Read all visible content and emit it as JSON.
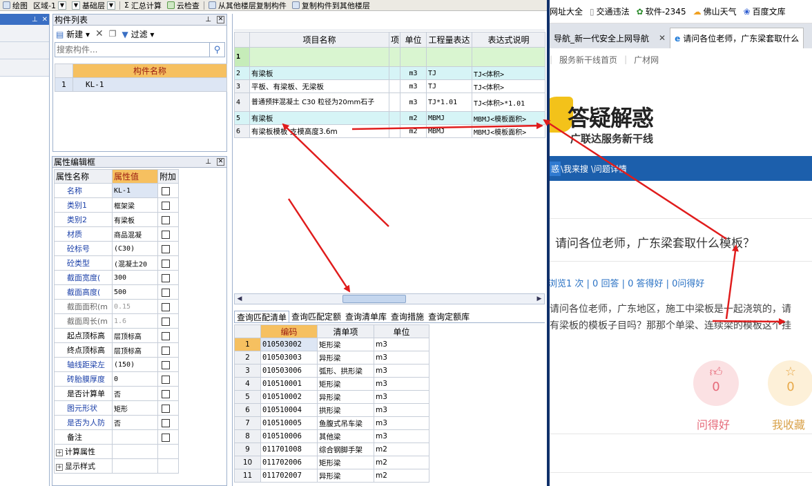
{
  "toolbar": {
    "items": [
      "绘图",
      "区域-1",
      "基础层",
      "汇总计算",
      "云检查",
      "从其他楼层复制构件",
      "复制构件到其他楼层"
    ]
  },
  "component_list": {
    "title": "构件列表",
    "new_label": "新建",
    "filter_label": "过滤",
    "search_placeholder": "搜索构件...",
    "col_header": "构件名称",
    "rows": [
      {
        "num": "1",
        "name": "KL-1"
      }
    ]
  },
  "prop_editor": {
    "title": "属性编辑框",
    "headers": [
      "属性名称",
      "属性值",
      "附加"
    ],
    "rows": [
      {
        "name": "名称",
        "value": "KL-1"
      },
      {
        "name": "类别1",
        "value": "框架梁"
      },
      {
        "name": "类别2",
        "value": "有梁板"
      },
      {
        "name": "材质",
        "value": "商品混凝"
      },
      {
        "name": "砼标号",
        "value": "(C30)"
      },
      {
        "name": "砼类型",
        "value": "(混凝土20"
      },
      {
        "name": "截面宽度(",
        "value": "300"
      },
      {
        "name": "截面高度(",
        "value": "500"
      },
      {
        "name": "截面面积(m",
        "value": "0.15"
      },
      {
        "name": "截面周长(m",
        "value": "1.6"
      },
      {
        "name": "起点顶标高",
        "value": "层顶标高"
      },
      {
        "name": "终点顶标高",
        "value": "层顶标高"
      },
      {
        "name": "轴线距梁左",
        "value": "(150)"
      },
      {
        "name": "砖胎膜厚度",
        "value": "0"
      },
      {
        "name": "是否计算单",
        "value": "否"
      },
      {
        "name": "图元形状",
        "value": "矩形"
      },
      {
        "name": "是否为人防",
        "value": "否"
      },
      {
        "name": "备注",
        "value": ""
      }
    ],
    "groups": [
      "计算属性",
      "显示样式"
    ]
  },
  "main_table": {
    "headers": [
      "项目名称",
      "项",
      "单位",
      "工程量表达",
      "表达式说明"
    ],
    "rows": [
      {
        "num": "1",
        "name": "",
        "unit": "",
        "expr": "",
        "desc": ""
      },
      {
        "num": "2",
        "name": "有梁板",
        "unit": "m3",
        "expr": "TJ",
        "desc": "TJ<体积>"
      },
      {
        "num": "3",
        "name": "平板、有梁板、无梁板",
        "unit": "m3",
        "expr": "TJ",
        "desc": "TJ<体积>"
      },
      {
        "num": "4",
        "name": "普通预拌混凝土 C30 粒径为20mm石子",
        "unit": "m3",
        "expr": "TJ*1.01",
        "desc": "TJ<体积>*1.01"
      },
      {
        "num": "5",
        "name": "有梁板",
        "unit": "m2",
        "expr": "MBMJ",
        "desc": "MBMJ<模板面积>"
      },
      {
        "num": "6",
        "name": "有梁板模板 支模高度3.6m",
        "unit": "m2",
        "expr": "MBMJ",
        "desc": "MBMJ<模板面积>"
      }
    ]
  },
  "query_tabs": [
    "查询匹配清单",
    "查询匹配定额",
    "查询清单库",
    "查询措施",
    "查询定额库"
  ],
  "query_table": {
    "headers": [
      "编码",
      "清单项",
      "单位"
    ],
    "rows": [
      {
        "num": "1",
        "code": "010503002",
        "item": "矩形梁",
        "unit": "m3"
      },
      {
        "num": "2",
        "code": "010503003",
        "item": "异形梁",
        "unit": "m3"
      },
      {
        "num": "3",
        "code": "010503006",
        "item": "弧形、拱形梁",
        "unit": "m3"
      },
      {
        "num": "4",
        "code": "010510001",
        "item": "矩形梁",
        "unit": "m3"
      },
      {
        "num": "5",
        "code": "010510002",
        "item": "异形梁",
        "unit": "m3"
      },
      {
        "num": "6",
        "code": "010510004",
        "item": "拱形梁",
        "unit": "m3"
      },
      {
        "num": "7",
        "code": "010510005",
        "item": "鱼腹式吊车梁",
        "unit": "m3"
      },
      {
        "num": "8",
        "code": "010510006",
        "item": "其他梁",
        "unit": "m3"
      },
      {
        "num": "9",
        "code": "011701008",
        "item": "综合钢脚手架",
        "unit": "m2"
      },
      {
        "num": "10",
        "code": "011702006",
        "item": "矩形梁",
        "unit": "m2"
      },
      {
        "num": "11",
        "code": "011702007",
        "item": "异形梁",
        "unit": "m2"
      }
    ]
  },
  "browser": {
    "bookmarks": [
      "网址大全",
      "交通违法",
      "软件-2345",
      "佛山天气",
      "百度文库"
    ],
    "tab1": "导航_新一代安全上网导航",
    "tab2": "请问各位老师，广东梁套取什么",
    "nav": [
      "服务新干线首页",
      "广材网"
    ],
    "logo": "答疑解惑",
    "logo_sub": "广联达服务新干线",
    "bluebar": [
      "惑",
      "\\我来搜 \\问题详情"
    ],
    "question_title": "请问各位老师，广东梁套取什么模板？",
    "stats": "浏览1 次 | 0 回答 | 0 答得好 | 0问得好",
    "body_line1": "请问各位老师，广东地区，施工中梁板是一起浇筑的，请",
    "body_line2": "有梁板的模板子目吗？那那个单梁、连续梁的模板这个挂",
    "btn1_count": "0",
    "btn1_label": "问得好",
    "btn2_count": "0",
    "btn2_label": "我收藏"
  },
  "colors": {
    "accent": "#f6c060",
    "arrow": "#e01c1c",
    "bluebar": "#1c5fac"
  }
}
